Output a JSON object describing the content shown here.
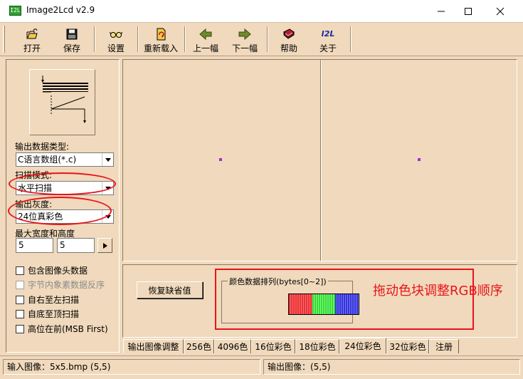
{
  "window": {
    "title": "Image2Lcd v2.9",
    "icon_text": "I2L"
  },
  "toolbar": {
    "open": "打开",
    "save": "保存",
    "settings": "设置",
    "reload": "重新载入",
    "prev": "上一幅",
    "next": "下一幅",
    "help": "帮助",
    "about": "关于",
    "about_icon_text": "I2L"
  },
  "left": {
    "output_type_label": "输出数据类型:",
    "output_type_value": "C语言数组(*.c)",
    "scan_mode_label": "扫描模式:",
    "scan_mode_value": "水平扫描",
    "gray_label": "输出灰度:",
    "gray_value": "24位真彩色",
    "size_label": "最大宽度和高度",
    "width_value": "5",
    "height_value": "5",
    "checkboxes": [
      {
        "label": "包含图像头数据",
        "enabled": true
      },
      {
        "label": "字节内象素数据反序",
        "enabled": false
      },
      {
        "label": "自右至左扫描",
        "enabled": true
      },
      {
        "label": "自底至顶扫描",
        "enabled": true
      },
      {
        "label": "高位在前(MSB First)",
        "enabled": true
      }
    ]
  },
  "bottom": {
    "restore_button": "恢复缺省值",
    "group_title": "颜色数据排列(bytes[0~2])",
    "annotation": "拖动色块调整RGB顺序"
  },
  "tabs": [
    {
      "label": "输出图像调整",
      "active": false
    },
    {
      "label": "256色",
      "active": false
    },
    {
      "label": "4096色",
      "active": false
    },
    {
      "label": "16位彩色",
      "active": false
    },
    {
      "label": "18位彩色",
      "active": false
    },
    {
      "label": "24位彩色",
      "active": true
    },
    {
      "label": "32位彩色",
      "active": false
    },
    {
      "label": "注册",
      "active": false
    }
  ],
  "status": {
    "input": "输入图像：5x5.bmp (5,5)",
    "output": "输出图像：(5,5)"
  },
  "colors": {
    "background": "#f0d9bc",
    "annotation": "#e8141a",
    "pixel": "#9b2fe0",
    "red_block": "#e8333a",
    "green_block": "#33dd33",
    "blue_block": "#3333dd"
  }
}
